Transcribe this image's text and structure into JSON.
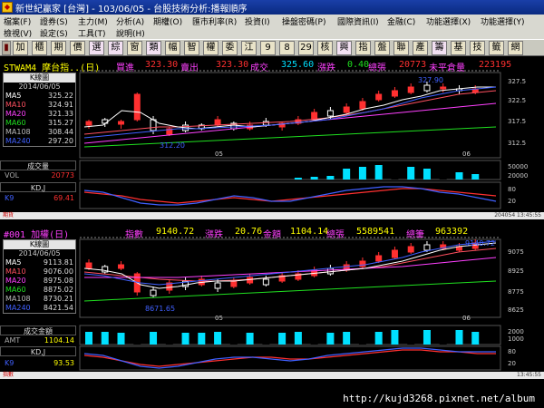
{
  "window": {
    "title": "新世紀贏家 [台灣] - 103/06/05 - 台股技術分析:播報順序"
  },
  "menu": {
    "row1": [
      "檔案(F)",
      "證券(S)",
      "主力(M)",
      "分析(A)",
      "期權(O)",
      "匯市利率(R)",
      "投資(I)",
      "操盤密碼(P)",
      "國際資訊(I)",
      "金融(C)",
      "功能選擇(X)",
      "功能選擇(Y)"
    ],
    "row2": [
      "檢視(V)",
      "設定(S)",
      "工具(T)",
      "說明(H)"
    ]
  },
  "toolbar": [
    "加",
    "櫃",
    "期",
    "價",
    "選",
    "綜",
    "窗",
    "類",
    "幅",
    "智",
    "權",
    "委",
    "江",
    "9",
    "8",
    "29",
    "核",
    "興",
    "指",
    "盤",
    "聯",
    "產",
    "籌",
    "基",
    "技",
    "籤",
    "網"
  ],
  "panel1": {
    "symbol": "STWAM4 摩台指..(日)",
    "bid_label": "買進",
    "bid": "323.30",
    "ask_label": "賣出",
    "ask": "323.30",
    "last_label": "成交",
    "last": "325.60",
    "chg_label": "漲跌",
    "chg": "0.40",
    "vol_label": "總張",
    "vol": "20773",
    "oi_label": "未平倉量",
    "oi": "223195",
    "chart_title": "K線圖",
    "date": "2014/06/05",
    "ma": [
      {
        "name": "MA5",
        "value": "325.22",
        "color": "#ffffff"
      },
      {
        "name": "MA10",
        "value": "324.91",
        "color": "#ff5060"
      },
      {
        "name": "MA20",
        "value": "321.33",
        "color": "#ff40ff"
      },
      {
        "name": "MA60",
        "value": "315.27",
        "color": "#20e020"
      },
      {
        "name": "MA108",
        "value": "308.44",
        "color": "#bbbbbb"
      },
      {
        "name": "MA240",
        "value": "297.20",
        "color": "#4060ff"
      }
    ],
    "high_label": "327.90",
    "low_label": "312.20",
    "vol_section": "成交量",
    "vol_name": "VOL",
    "vol_value": "20773",
    "kd_section": "KD,J",
    "k_name": "K9",
    "k_value": "69.41",
    "tag": "期貨",
    "status": "204054 13:45:55"
  },
  "panel2": {
    "symbol": "#001 加權(日)",
    "idx_label": "指數",
    "idx": "9140.72",
    "chg_label": "漲跌",
    "chg": "20.76",
    "amt_label": "金額",
    "amt": "1104.14",
    "vol_label": "總張",
    "vol": "5589541",
    "cnt_label": "總筆",
    "cnt": "963392",
    "chart_title": "K線圖",
    "date": "2014/06/05",
    "ma": [
      {
        "name": "MA5",
        "value": "9113.81",
        "color": "#ffffff"
      },
      {
        "name": "MA10",
        "value": "9076.00",
        "color": "#ff5060"
      },
      {
        "name": "MA20",
        "value": "8975.08",
        "color": "#ff40ff"
      },
      {
        "name": "MA60",
        "value": "8875.02",
        "color": "#20e020"
      },
      {
        "name": "MA108",
        "value": "8730.21",
        "color": "#bbbbbb"
      },
      {
        "name": "MA240",
        "value": "8421.54",
        "color": "#4060ff"
      }
    ],
    "high_label": "9140.72",
    "low_label": "8671.65",
    "vol_section": "成交金額",
    "vol_name": "AMT",
    "vol_value": "1104.14",
    "kd_section": "KD,J",
    "k_name": "K9",
    "k_value": "93.53",
    "tag": "指數",
    "status": "13:45:55"
  },
  "axes": {
    "p1_price": [
      "327.5",
      "322.5",
      "317.5",
      "312.5"
    ],
    "p1_vol": [
      "50000",
      "20000"
    ],
    "p1_kd": [
      "80",
      "20"
    ],
    "p2_price": [
      "9075",
      "8925",
      "8775",
      "8625"
    ],
    "p2_vol": [
      "2000",
      "1000"
    ],
    "p2_kd": [
      "80",
      "20"
    ],
    "dates": [
      "05",
      "06"
    ]
  },
  "footer": {
    "url": "http://kujd3268.pixnet.net/album"
  },
  "colors": {
    "up": "#ff3030",
    "down": "#00e0ff",
    "neutral": "#ffffff",
    "accent_yellow": "#ffff00",
    "accent_magenta": "#ff40ff"
  }
}
